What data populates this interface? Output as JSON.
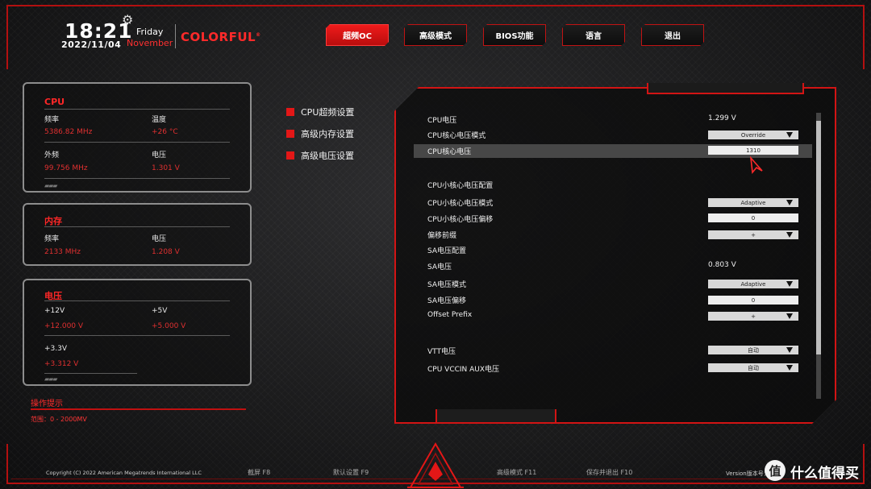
{
  "header": {
    "time": "18:21",
    "date": "2022/11/04",
    "weekday": "Friday",
    "month": "November",
    "brand": "COLORFUL",
    "brand_mark": "®",
    "gear_icon": "gear-icon"
  },
  "tabs": [
    {
      "label": "超频OC",
      "active": true
    },
    {
      "label": "高级模式",
      "active": false
    },
    {
      "label": "BIOS功能",
      "active": false
    },
    {
      "label": "语言",
      "active": false
    },
    {
      "label": "退出",
      "active": false
    }
  ],
  "cpu_panel": {
    "title": "CPU",
    "freq_label": "频率",
    "freq_value": "5386.82 MHz",
    "temp_label": "温度",
    "temp_value": "+26 °C",
    "ext_label": "外频",
    "ext_value": "99.756 MHz",
    "volt_label": "电压",
    "volt_value": "1.301 V"
  },
  "mem_panel": {
    "title": "内存",
    "freq_label": "频率",
    "freq_value": "2133 MHz",
    "volt_label": "电压",
    "volt_value": "1.208 V"
  },
  "volt_panel": {
    "title": "电压",
    "v12_label": "+12V",
    "v12_value": "+12.000 V",
    "v5_label": "+5V",
    "v5_value": "+5.000 V",
    "v33_label": "+3.3V",
    "v33_value": "+3.312 V"
  },
  "hint": {
    "title": "操作提示",
    "text": "范围：0 - 2000MV"
  },
  "menu": [
    {
      "label": "CPU超频设置"
    },
    {
      "label": "高级内存设置"
    },
    {
      "label": "高级电压设置"
    }
  ],
  "settings": [
    {
      "label": "CPU电压",
      "value": "1.299 V"
    },
    {
      "label": "CPU核心电压模式",
      "value": "Override"
    },
    {
      "label": "CPU核心电压",
      "value": "1310"
    },
    {
      "label": "CPU小核心电压配置"
    },
    {
      "label": "CPU小核心电压模式",
      "value": "Adaptive"
    },
    {
      "label": "CPU小核心电压偏移",
      "value": "0"
    },
    {
      "label": "偏移前缀",
      "value": "+"
    },
    {
      "label": "SA电压配置"
    },
    {
      "label": "SA电压",
      "value": "0.803 V"
    },
    {
      "label": "SA电压模式",
      "value": "Adaptive"
    },
    {
      "label": "SA电压偏移",
      "value": "0"
    },
    {
      "label": "Offset Prefix",
      "value": "+"
    },
    {
      "label": "VTT电压",
      "value": "自动"
    },
    {
      "label": "CPU VCCIN AUX电压",
      "value": "自动"
    }
  ],
  "footer": {
    "copyright": "Copyright (C) 2022 American Megatrends International LLC",
    "keys": [
      "截屏 F8",
      "默认设置 F9",
      "高级模式 F11",
      "保存并退出 F10"
    ],
    "version": "Version版本号：",
    "watermark_badge": "值",
    "watermark_text": "什么值得买"
  },
  "colors": {
    "accent": "#e31717",
    "panel_border": "#8d8d8d",
    "value_red": "#e03030"
  }
}
